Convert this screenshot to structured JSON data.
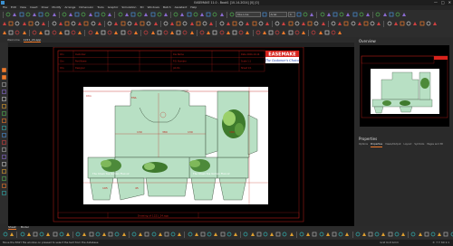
{
  "window": {
    "title": "EASEMAKE 11.0 - Book1 [10-14-2024] [0] [0]",
    "min": "—",
    "max": "□",
    "close": "✕"
  },
  "menu": [
    "File",
    "Edit",
    "View",
    "Insert",
    "Draw",
    "Modify",
    "Arrange",
    "Dimension",
    "Tools",
    "Graphic",
    "Simulation",
    "3D",
    "Windows",
    "Batch",
    "Assistant",
    "Help"
  ],
  "toolbar": {
    "layer": "Die-Line",
    "font": "Arial",
    "size": "4"
  },
  "tabs": [
    {
      "label": "Welcome"
    },
    {
      "label": "1221_24.app"
    }
  ],
  "right_panel": {
    "overview_title": "Overview",
    "properties_title": "Properties",
    "prop_tabs": [
      "Options",
      "Properties",
      "Views/Output",
      "Layout",
      "Symbols",
      "Pages and 3D"
    ]
  },
  "drawing": {
    "brand": "EASEMAKE",
    "brand_sub": "The Customer's Choice",
    "box_text": "The Green Tea Garden Flavour",
    "shape_label": "FAIL",
    "titleblock_rows": [
      [
        "Chn",
        "Customer",
        "",
        "",
        "Die Name",
        "",
        "Date 2024-10-14"
      ],
      [
        "Chn",
        "Part Name",
        "",
        "",
        "P.O. Number",
        "",
        "Scale 1:1"
      ],
      [
        "Cha",
        "Designer",
        "",
        "",
        "Job No",
        "",
        "Sheet 1/1"
      ]
    ],
    "footer_label": "Drawing of 1221_24.app",
    "dims": [
      "130",
      "380",
      "130",
      "180",
      "195",
      "45"
    ]
  },
  "bottom_tabs": [
    {
      "label": "Sheet"
    },
    {
      "label": "Model"
    }
  ],
  "status": {
    "left": "Move the EASY file window on pressed to select the text from the database",
    "mid": "Grid Unit 1mm",
    "right": "X: 7 Y: 60  1:1"
  },
  "colors": {
    "accent": "#f07a2a",
    "canvas": "#000000",
    "cutline": "#c0201a",
    "box_fill": "#b8e0c4"
  }
}
